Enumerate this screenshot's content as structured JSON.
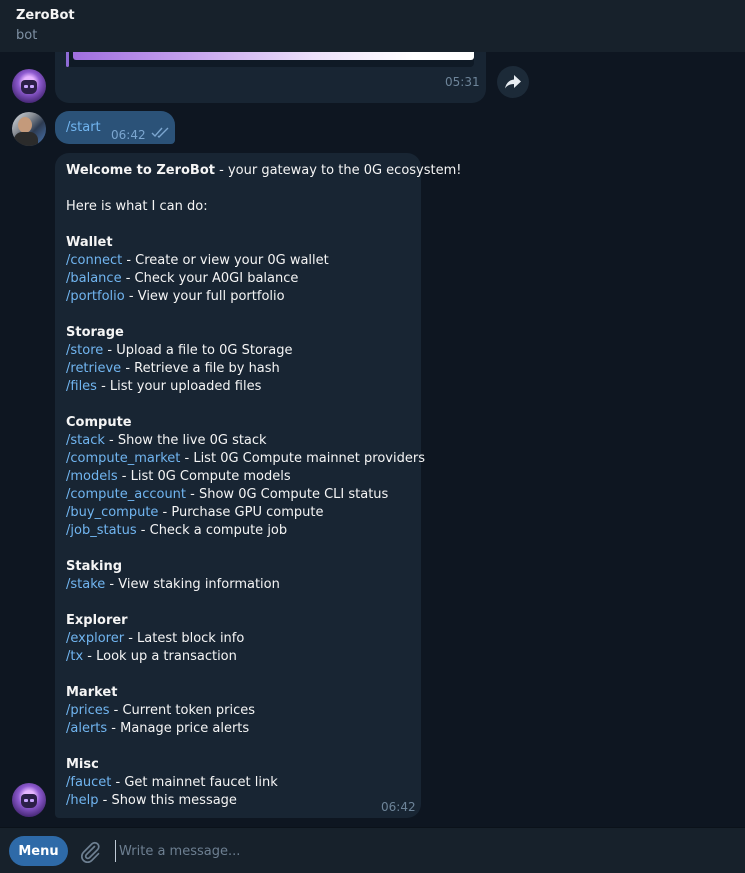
{
  "header": {
    "title": "ZeroBot",
    "subtitle": "bot"
  },
  "messages": {
    "previous": {
      "time": "05:31"
    },
    "start": {
      "text": "/start",
      "time": "06:42"
    },
    "welcome": {
      "time": "06:42",
      "intro_bold": "Welcome to ZeroBot",
      "intro_rest": " - your gateway to the 0G ecosystem!",
      "subtitle": "Here is what I can do:",
      "sections": [
        {
          "title": "Wallet",
          "commands": [
            {
              "cmd": "/connect",
              "desc": " - Create or view your 0G wallet"
            },
            {
              "cmd": "/balance",
              "desc": " - Check your A0GI balance"
            },
            {
              "cmd": "/portfolio",
              "desc": " - View your full portfolio"
            }
          ]
        },
        {
          "title": "Storage",
          "commands": [
            {
              "cmd": "/store",
              "desc": " - Upload a file to 0G Storage"
            },
            {
              "cmd": "/retrieve",
              "desc": " - Retrieve a file by hash"
            },
            {
              "cmd": "/files",
              "desc": " - List your uploaded files"
            }
          ]
        },
        {
          "title": "Compute",
          "commands": [
            {
              "cmd": "/stack",
              "desc": " - Show the live 0G stack"
            },
            {
              "cmd": "/compute_market",
              "desc": " - List 0G Compute mainnet providers"
            },
            {
              "cmd": "/models",
              "desc": " - List 0G Compute models"
            },
            {
              "cmd": "/compute_account",
              "desc": " - Show 0G Compute CLI status"
            },
            {
              "cmd": "/buy_compute",
              "desc": " - Purchase GPU compute"
            },
            {
              "cmd": "/job_status",
              "desc": " - Check a compute job"
            }
          ]
        },
        {
          "title": "Staking",
          "commands": [
            {
              "cmd": "/stake",
              "desc": " - View staking information"
            }
          ]
        },
        {
          "title": "Explorer",
          "commands": [
            {
              "cmd": "/explorer",
              "desc": " - Latest block info"
            },
            {
              "cmd": "/tx",
              "desc": " - Look up a transaction"
            }
          ]
        },
        {
          "title": "Market",
          "commands": [
            {
              "cmd": "/prices",
              "desc": " - Current token prices"
            },
            {
              "cmd": "/alerts",
              "desc": " - Manage price alerts"
            }
          ]
        },
        {
          "title": "Misc",
          "commands": [
            {
              "cmd": "/faucet",
              "desc": " - Get mainnet faucet link"
            },
            {
              "cmd": "/help",
              "desc": " - Show this message"
            }
          ]
        }
      ]
    }
  },
  "composer": {
    "menu_label": "Menu",
    "placeholder": "Write a message..."
  },
  "icons": {
    "share": "share-arrow-icon",
    "attach": "paperclip-icon",
    "read": "double-check-icon"
  },
  "colors": {
    "background": "#0e1621",
    "bubble_in": "#182533",
    "bubble_out": "#2b5278",
    "link": "#71b5f0",
    "menu": "#2e6aa8"
  }
}
